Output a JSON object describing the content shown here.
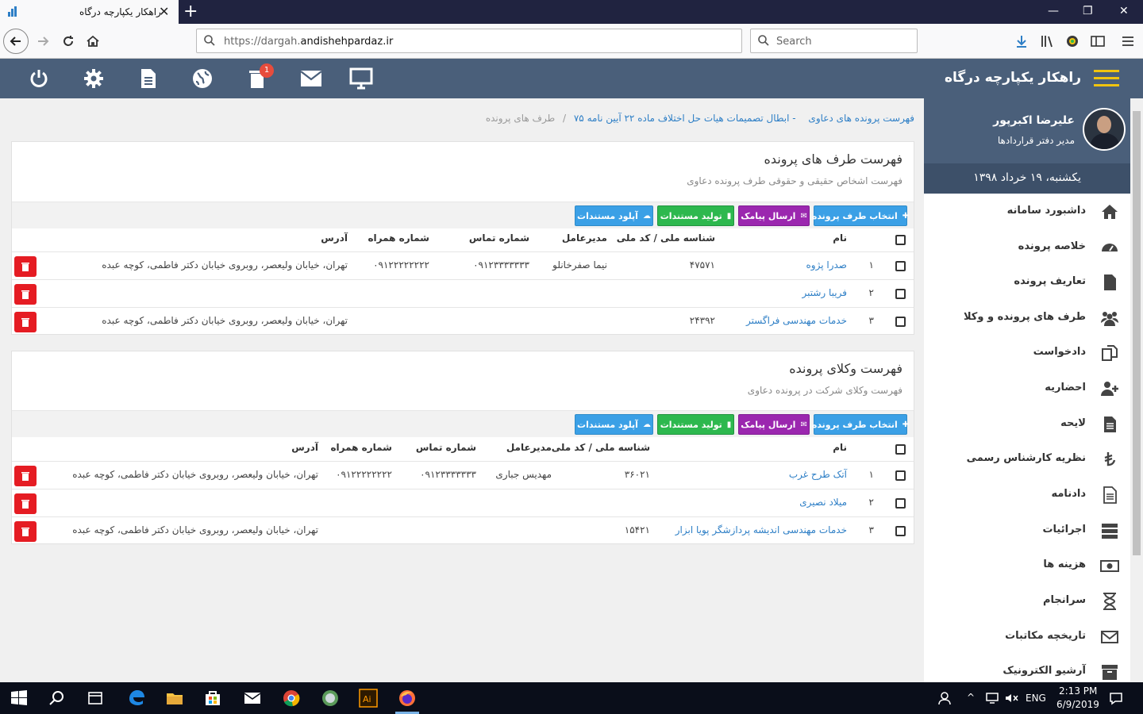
{
  "browser": {
    "tab_title": "راهکار یکپارچه درگاه",
    "tab_close": "✕",
    "tab_new": "+",
    "url_prefix": "https://dargah.",
    "url_host": "andishehpardaz.ir",
    "search_placeholder": "Search"
  },
  "header": {
    "app_title": "راهکار یکپارچه درگاه",
    "notification_count": "1",
    "icons": [
      "power-icon",
      "gear-icon",
      "document-icon",
      "globe-icon",
      "trash-icon",
      "mail-icon",
      "monitor-icon"
    ]
  },
  "profile": {
    "name": "علیرضا اکبرپور",
    "role": "مدیر دفتر قراردادها",
    "date": "یکشنبه، ۱۹ خرداد ۱۳۹۸"
  },
  "sidebar": {
    "items": [
      {
        "label": "داشبورد سامانه",
        "icon": "home-icon"
      },
      {
        "label": "خلاصه پرونده",
        "icon": "dashboard-icon"
      },
      {
        "label": "تعاریف پرونده",
        "icon": "file-icon"
      },
      {
        "label": "طرف های پرونده و وکلا",
        "icon": "users-icon"
      },
      {
        "label": "دادخواست",
        "icon": "copy-icon"
      },
      {
        "label": "احضاریه",
        "icon": "user-plus-icon"
      },
      {
        "label": "لایحه",
        "icon": "file-text-icon"
      },
      {
        "label": "نظریه کارشناس رسمی",
        "icon": "lira-icon"
      },
      {
        "label": "دادنامه",
        "icon": "file-outline-icon"
      },
      {
        "label": "اجرائیات",
        "icon": "server-icon"
      },
      {
        "label": "هزینه ها",
        "icon": "money-icon"
      },
      {
        "label": "سرانجام",
        "icon": "hourglass-icon"
      },
      {
        "label": "تاریخچه مکاتبات",
        "icon": "envelope-icon"
      },
      {
        "label": "آرشیو الکترونیک",
        "icon": "archive-icon"
      }
    ]
  },
  "breadcrumb": {
    "item1": "فهرست پرونده های دعاوی",
    "item2": "- ابطال تصمیمات هیات حل اختلاف ماده ۲۲ آیین نامه ۷۵",
    "current": "طرف های پرونده",
    "separator": "/"
  },
  "buttons": {
    "select_party": "انتخاب طرف پرونده",
    "send_sms": "ارسال پیامک",
    "generate_docs": "تولید مستندات",
    "upload_docs": "آپلود مستندات"
  },
  "columns": {
    "name": "نام",
    "national_id": "شناسه ملی / کد ملی",
    "ceo": "مدیرعامل",
    "phone": "شماره تماس",
    "mobile": "شماره همراه",
    "address": "آدرس"
  },
  "parties_panel": {
    "title": "فهرست طرف های پرونده",
    "subtitle": "فهرست اشخاص حقیقی و حقوقی طرف پرونده دعاوی",
    "rows": [
      {
        "num": "۱",
        "name": "صدرا پژوه",
        "national_id": "۴۷۵۷۱",
        "ceo": "نیما صفرخانلو",
        "phone": "۰۹۱۲۳۳۳۳۳۳۳",
        "mobile": "۰۹۱۲۲۲۲۲۲۲۲",
        "address": "تهران، خیابان ولیعصر، روبروی خیابان دکتر فاطمی، کوچه عبده"
      },
      {
        "num": "۲",
        "name": "فریبا رشتبر",
        "national_id": "",
        "ceo": "",
        "phone": "",
        "mobile": "",
        "address": ""
      },
      {
        "num": "۳",
        "name": "خدمات مهندسی فراگستر",
        "national_id": "۲۴۳۹۲",
        "ceo": "",
        "phone": "",
        "mobile": "",
        "address": "تهران، خیابان ولیعصر، روبروی خیابان دکتر فاطمی، کوچه عبده"
      }
    ]
  },
  "lawyers_panel": {
    "title": "فهرست وکلای پرونده",
    "subtitle": "فهرست وکلای شرکت در پرونده دعاوی",
    "rows": [
      {
        "num": "۱",
        "name": "آتک طرح غرب",
        "national_id": "۳۶۰۲۱",
        "ceo": "مهدیس جباری",
        "phone": "۰۹۱۲۳۳۳۳۳۳۳",
        "mobile": "۰۹۱۲۲۲۲۲۲۲۲",
        "address": "تهران، خیابان ولیعصر، روبروی خیابان دکتر فاطمی، کوچه عبده"
      },
      {
        "num": "۲",
        "name": "میلاد نصیری",
        "national_id": "",
        "ceo": "",
        "phone": "",
        "mobile": "",
        "address": ""
      },
      {
        "num": "۳",
        "name": "خدمات مهندسی اندیشه پردازشگر پویا ابزار",
        "national_id": "۱۵۴۲۱",
        "ceo": "",
        "phone": "",
        "mobile": "",
        "address": "تهران، خیابان ولیعصر، روبروی خیابان دکتر فاطمی، کوچه عبده"
      }
    ]
  },
  "taskbar": {
    "lang": "ENG",
    "time": "2:13 PM",
    "date": "6/9/2019"
  },
  "colors": {
    "header": "#4a5f7a",
    "link": "#2e7fc6",
    "btn_blue": "#3ba0e6",
    "btn_purple": "#9b27af",
    "btn_green": "#2db84e",
    "delete": "#e51c23",
    "accent": "#f1c40f"
  }
}
